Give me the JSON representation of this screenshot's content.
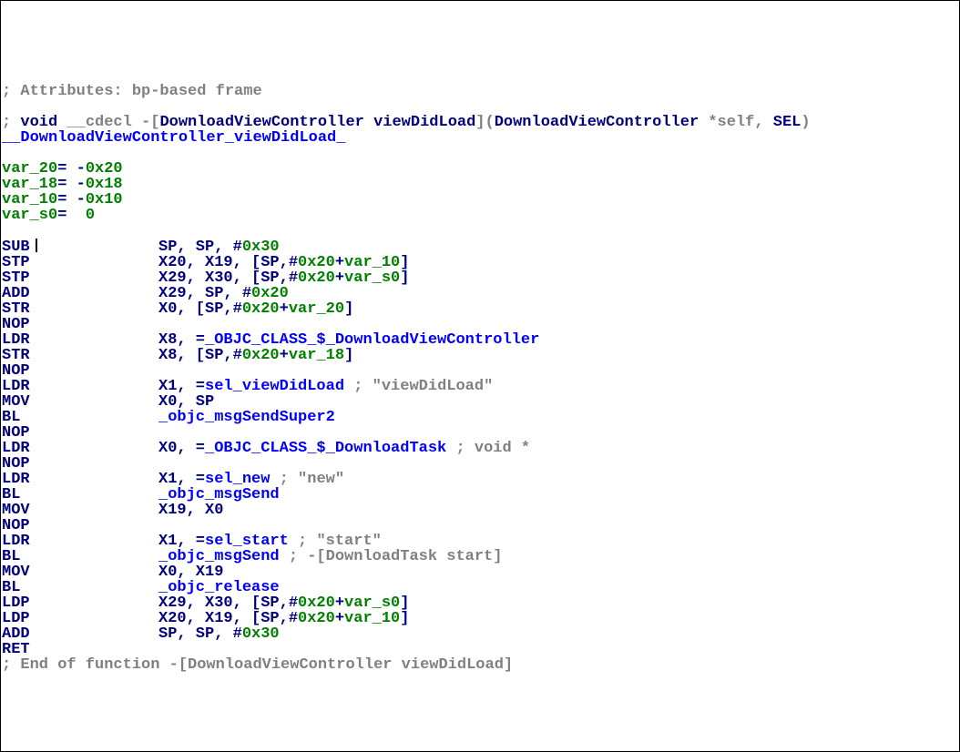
{
  "attr_comment": "; Attributes: bp-based frame",
  "decl_comment": {
    "lead": "; ",
    "ret": "void",
    "cc": " __cdecl -[",
    "cls": "DownloadViewController viewDidLoad",
    "mid": "](",
    "arg1": "DownloadViewController",
    "star": " *self, ",
    "arg2": "SEL",
    "end": ")"
  },
  "fn_label": "__DownloadViewController_viewDidLoad_",
  "vars": {
    "v20": "var_20",
    "v20e": "= -",
    "v20n": "0x20",
    "v18": "var_18",
    "v18e": "= -",
    "v18n": "0x18",
    "v10": "var_10",
    "v10e": "= -",
    "v10n": "0x10",
    "s0": "var_s0",
    "s0e": "=  ",
    "s0n": "0"
  },
  "l": [
    {
      "mn": "SUB",
      "ops": [
        [
          "SP, SP, #",
          "navy"
        ],
        [
          "0x30",
          "green"
        ]
      ],
      "cursor": true
    },
    {
      "mn": "STP",
      "ops": [
        [
          "X20, X19, [SP,#",
          "navy"
        ],
        [
          "0x20",
          "green"
        ],
        [
          "+",
          "navy"
        ],
        [
          "var_10",
          "green"
        ],
        [
          "]",
          "navy"
        ]
      ]
    },
    {
      "mn": "STP",
      "ops": [
        [
          "X29, X30, [SP,#",
          "navy"
        ],
        [
          "0x20",
          "green"
        ],
        [
          "+",
          "navy"
        ],
        [
          "var_s0",
          "green"
        ],
        [
          "]",
          "navy"
        ]
      ]
    },
    {
      "mn": "ADD",
      "ops": [
        [
          "X29, SP, #",
          "navy"
        ],
        [
          "0x20",
          "green"
        ]
      ]
    },
    {
      "mn": "STR",
      "ops": [
        [
          "X0, [SP,#",
          "navy"
        ],
        [
          "0x20",
          "green"
        ],
        [
          "+",
          "navy"
        ],
        [
          "var_20",
          "green"
        ],
        [
          "]",
          "navy"
        ]
      ]
    },
    {
      "mn": "NOP",
      "ops": []
    },
    {
      "mn": "LDR",
      "ops": [
        [
          "X8, =",
          "navy"
        ],
        [
          "_OBJC_CLASS_$_DownloadViewController",
          "blue"
        ]
      ]
    },
    {
      "mn": "STR",
      "ops": [
        [
          "X8, [SP,#",
          "navy"
        ],
        [
          "0x20",
          "green"
        ],
        [
          "+",
          "navy"
        ],
        [
          "var_18",
          "green"
        ],
        [
          "]",
          "navy"
        ]
      ]
    },
    {
      "mn": "NOP",
      "ops": []
    },
    {
      "mn": "LDR",
      "ops": [
        [
          "X1, =",
          "navy"
        ],
        [
          "sel_viewDidLoad",
          "blue"
        ],
        [
          " ; \"viewDidLoad\"",
          "gray"
        ]
      ]
    },
    {
      "mn": "MOV",
      "ops": [
        [
          "X0, SP",
          "navy"
        ]
      ]
    },
    {
      "mn": "BL",
      "ops": [
        [
          "_objc_msgSendSuper2",
          "blue"
        ]
      ]
    },
    {
      "mn": "NOP",
      "ops": []
    },
    {
      "mn": "LDR",
      "ops": [
        [
          "X0, =",
          "navy"
        ],
        [
          "_OBJC_CLASS_$_DownloadTask",
          "blue"
        ],
        [
          " ; void *",
          "gray"
        ]
      ]
    },
    {
      "mn": "NOP",
      "ops": []
    },
    {
      "mn": "LDR",
      "ops": [
        [
          "X1, =",
          "navy"
        ],
        [
          "sel_new",
          "blue"
        ],
        [
          " ; \"new\"",
          "gray"
        ]
      ]
    },
    {
      "mn": "BL",
      "ops": [
        [
          "_objc_msgSend",
          "blue"
        ]
      ]
    },
    {
      "mn": "MOV",
      "ops": [
        [
          "X19, X0",
          "navy"
        ]
      ]
    },
    {
      "mn": "NOP",
      "ops": []
    },
    {
      "mn": "LDR",
      "ops": [
        [
          "X1, =",
          "navy"
        ],
        [
          "sel_start",
          "blue"
        ],
        [
          " ; \"start\"",
          "gray"
        ]
      ]
    },
    {
      "mn": "BL",
      "ops": [
        [
          "_objc_msgSend",
          "blue"
        ],
        [
          " ; -[DownloadTask start]",
          "gray"
        ]
      ]
    },
    {
      "mn": "MOV",
      "ops": [
        [
          "X0, X19",
          "navy"
        ]
      ]
    },
    {
      "mn": "BL",
      "ops": [
        [
          "_objc_release",
          "blue"
        ]
      ]
    },
    {
      "mn": "LDP",
      "ops": [
        [
          "X29, X30, [SP,#",
          "navy"
        ],
        [
          "0x20",
          "green"
        ],
        [
          "+",
          "navy"
        ],
        [
          "var_s0",
          "green"
        ],
        [
          "]",
          "navy"
        ]
      ]
    },
    {
      "mn": "LDP",
      "ops": [
        [
          "X20, X19, [SP,#",
          "navy"
        ],
        [
          "0x20",
          "green"
        ],
        [
          "+",
          "navy"
        ],
        [
          "var_10",
          "green"
        ],
        [
          "]",
          "navy"
        ]
      ]
    },
    {
      "mn": "ADD",
      "ops": [
        [
          "SP, SP, #",
          "navy"
        ],
        [
          "0x30",
          "green"
        ]
      ]
    },
    {
      "mn": "RET",
      "ops": []
    }
  ],
  "end_comment": "; End of function -[DownloadViewController viewDidLoad]"
}
